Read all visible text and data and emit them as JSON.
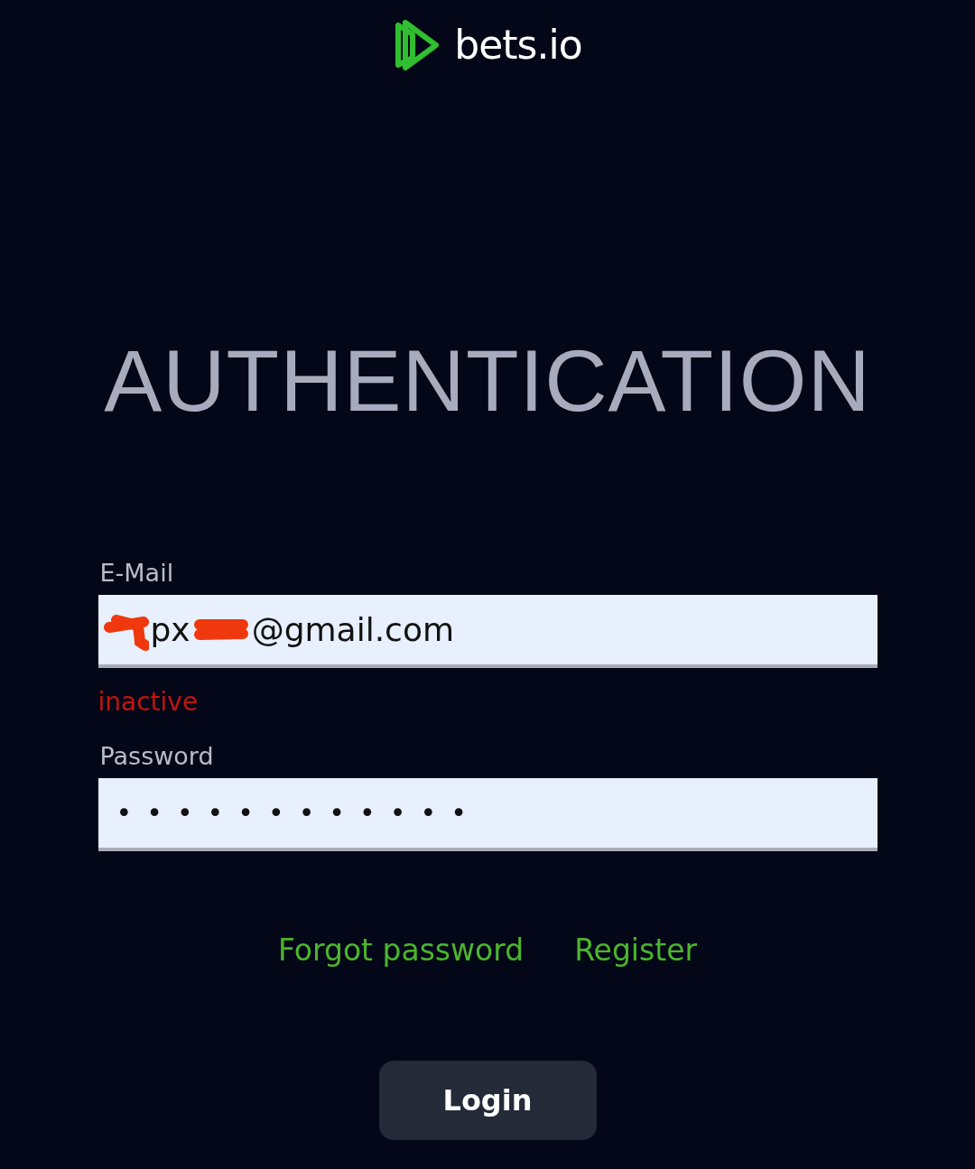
{
  "logo": {
    "text": "bets.io"
  },
  "title": "AUTHENTICATION",
  "email": {
    "label": "E-Mail",
    "value_parts": [
      "px",
      "@gmail.com"
    ],
    "redacted": true,
    "error": "inactive"
  },
  "password": {
    "label": "Password",
    "value": "••••••••••••"
  },
  "links": [
    "Forgot password",
    "Register"
  ],
  "login_button": "Login"
}
